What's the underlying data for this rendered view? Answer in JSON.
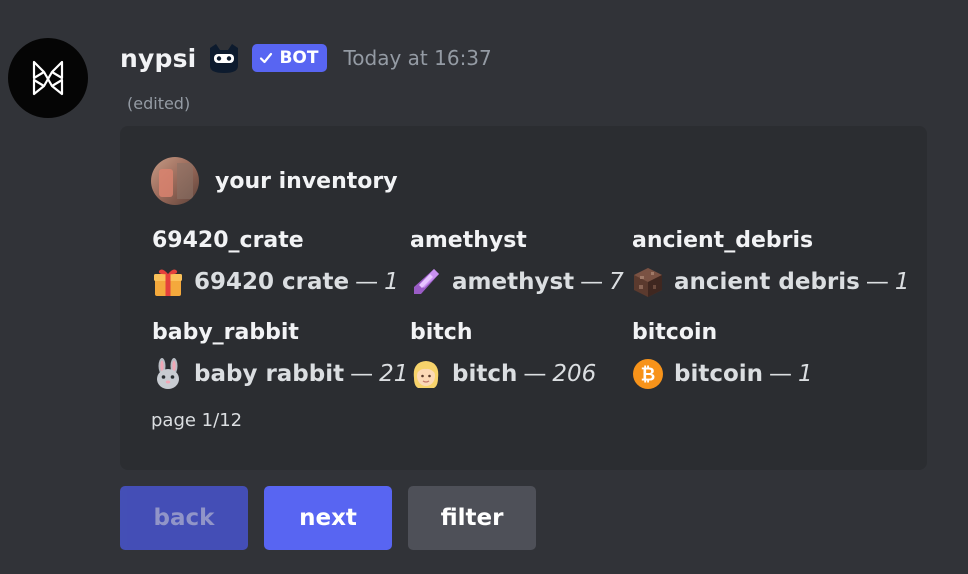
{
  "message": {
    "username": "nypsi",
    "user_emoji": "ninja-bot-icon",
    "bot_badge": "BOT",
    "timestamp": "Today at 16:37",
    "edited": "(edited)"
  },
  "embed": {
    "author": "your inventory",
    "fields": [
      {
        "name": "69420_crate",
        "icon": "gift-icon",
        "item": "69420 crate",
        "dash": "—",
        "qty": "1"
      },
      {
        "name": "amethyst",
        "icon": "amethyst-shard-icon",
        "item": "amethyst",
        "dash": "—",
        "qty": "7"
      },
      {
        "name": "ancient_debris",
        "icon": "ancient-debris-icon",
        "item": "ancient debris",
        "dash": "—",
        "qty": "1"
      },
      {
        "name": "baby_rabbit",
        "icon": "rabbit-icon",
        "item": "baby rabbit",
        "dash": "—",
        "qty": "21"
      },
      {
        "name": "bitch",
        "icon": "blonde-person-icon",
        "item": "bitch",
        "dash": "—",
        "qty": "206"
      },
      {
        "name": "bitcoin",
        "icon": "bitcoin-icon",
        "item": "bitcoin",
        "dash": "—",
        "qty": "1"
      }
    ],
    "footer": "page 1/12"
  },
  "buttons": {
    "back": "back",
    "next": "next",
    "filter": "filter"
  },
  "colors": {
    "background": "#313338",
    "embed": "#2b2d31",
    "blurple": "#5865f2",
    "blurple_disabled": "#4752c4",
    "secondary": "#4e5058",
    "muted_text": "#949ba4"
  }
}
